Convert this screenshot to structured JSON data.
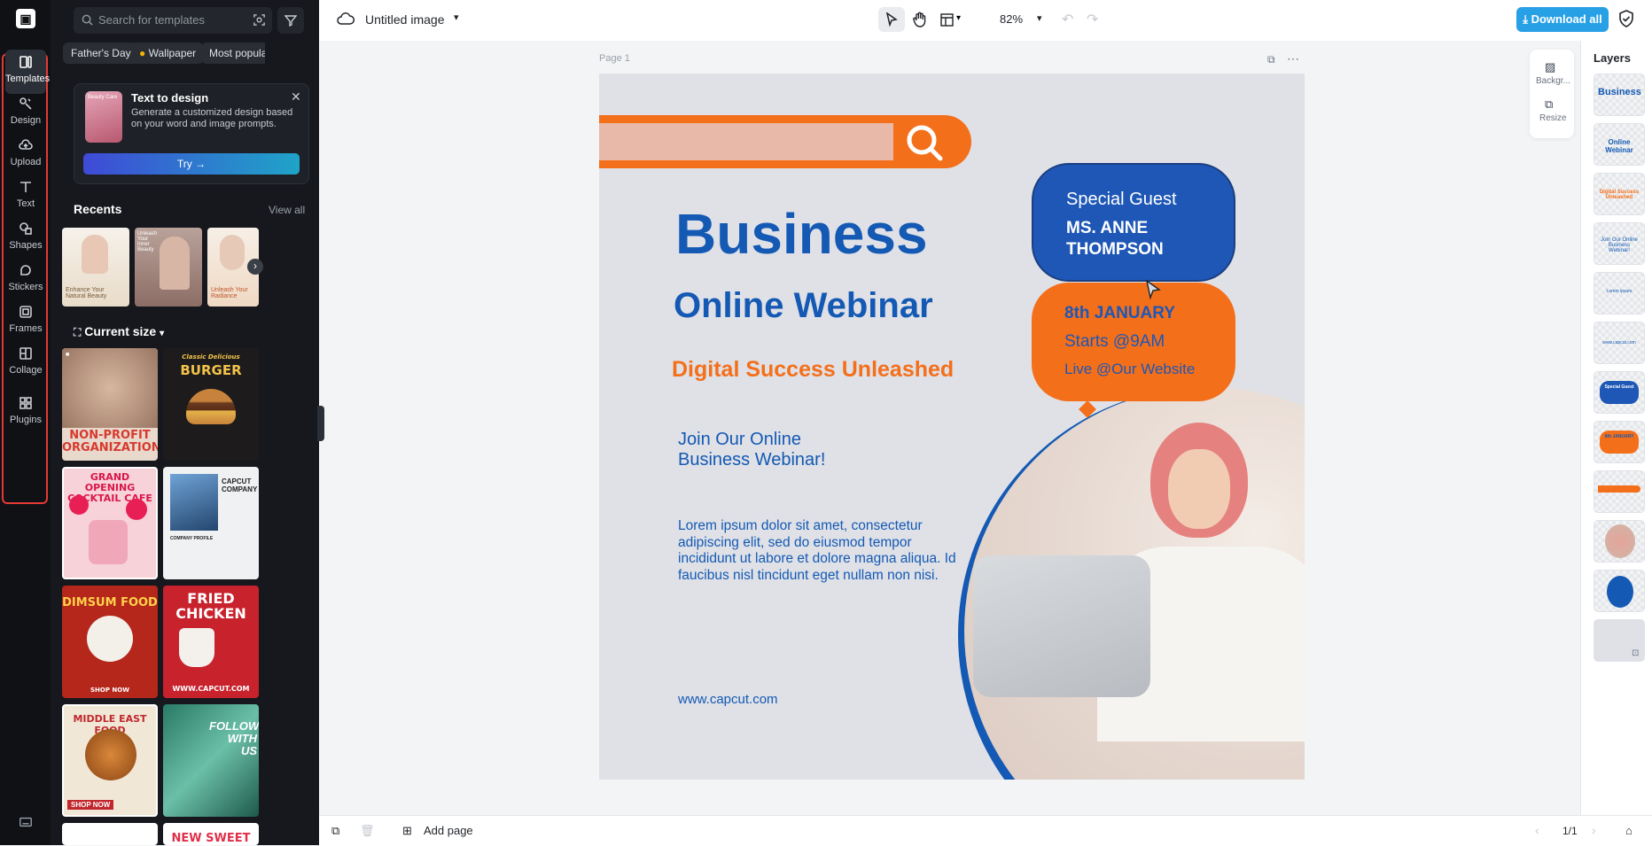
{
  "rail": {
    "items": [
      {
        "label": "Templates"
      },
      {
        "label": "Design"
      },
      {
        "label": "Upload"
      },
      {
        "label": "Text"
      },
      {
        "label": "Shapes"
      },
      {
        "label": "Stickers"
      },
      {
        "label": "Frames"
      },
      {
        "label": "Collage"
      },
      {
        "label": "Plugins"
      }
    ]
  },
  "panel": {
    "search_placeholder": "Search for templates",
    "chips": [
      "Father's Day",
      "Wallpaper",
      "Most popular"
    ],
    "text_to_design": {
      "thumb_caption": "Beauty Care",
      "title": "Text to design",
      "description": "Generate a customized design based on your word and image prompts.",
      "button": "Try →"
    },
    "recents": {
      "title": "Recents",
      "view_all": "View all",
      "items": [
        "Enhance Your Natural Beauty",
        "Unleash Your Inner Beauty",
        "Unleash Your Radiance"
      ]
    },
    "current_size": "Current size",
    "templates": [
      {
        "title": "NON-PROFIT ORGANIZATION"
      },
      {
        "title": "BURGER",
        "subtitle": "Classic Delicious"
      },
      {
        "title": "GRAND OPENING COCKTAIL CAFE"
      },
      {
        "title": "CAPCUT COMPANY",
        "subtitle": "COMPANY PROFILE"
      },
      {
        "title": "DIMSUM FOOD",
        "subtitle": "SHOP NOW"
      },
      {
        "title": "FRIED CHICKEN",
        "subtitle": "WWW.CAPCUT.COM"
      },
      {
        "title": "MIDDLE EAST FOOD",
        "subtitle": "SHOP NOW"
      },
      {
        "title": "FOLLOW WITH US"
      },
      {
        "title": "NEW SWEET"
      }
    ]
  },
  "topbar": {
    "title": "Untitled image",
    "zoom": "82%",
    "download": "Download all"
  },
  "canvas": {
    "page_label": "Page 1",
    "poster": {
      "headline": "Business",
      "subheadline": "Online Webinar",
      "tagline": "Digital Success Unleashed",
      "join_line1": "Join Our Online",
      "join_line2": "Business Webinar!",
      "lorem": "Lorem ipsum dolor sit amet, consectetur adipiscing elit, sed do eiusmod tempor incididunt ut labore et dolore magna aliqua. Id faucibus nisl tincidunt eget nullam non nisi.",
      "website": "www.capcut.com",
      "guest_label": "Special Guest",
      "guest_name_line1": "MS. ANNE",
      "guest_name_line2": "THOMPSON",
      "date": "8th JANUARY",
      "time": "Starts @9AM",
      "venue": "Live @Our Website"
    },
    "side_tools": [
      "Backgr...",
      "Resize"
    ]
  },
  "layers": {
    "title": "Layers",
    "items": [
      "Business",
      "Online Webinar",
      "Digital Success Unleashed",
      "Join Our Online Business Webinar!",
      "Lorem ipsum",
      "www.capcut.com",
      "Special Guest",
      "8th JANUARY",
      "search bar",
      "photo",
      "circle",
      "background"
    ]
  },
  "bottombar": {
    "add_page": "Add page",
    "page_count": "1/1"
  },
  "colors": {
    "brand_blue": "#1459b3",
    "brand_orange": "#f46f1a",
    "download_blue": "#28a0e6",
    "highlight_red": "#e53935"
  }
}
